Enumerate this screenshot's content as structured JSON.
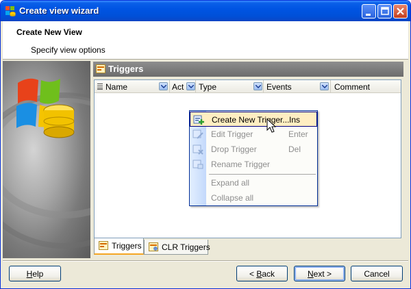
{
  "window": {
    "title": "Create view wizard",
    "icon": "windows-db-icon"
  },
  "header": {
    "title": "Create New View",
    "subtitle": "Specify view options"
  },
  "panel": {
    "title": "Triggers",
    "columns": [
      {
        "label": "Name",
        "dropdown": true
      },
      {
        "label": "Act",
        "dropdown": true
      },
      {
        "label": "Type",
        "dropdown": true
      },
      {
        "label": "Events",
        "dropdown": true
      },
      {
        "label": "Comment",
        "dropdown": false
      }
    ],
    "tabs": [
      {
        "label": "Triggers",
        "active": true
      },
      {
        "label": "CLR Triggers",
        "active": false
      }
    ]
  },
  "context_menu": {
    "items": [
      {
        "label": "Create New Trigger...",
        "shortcut": "Ins",
        "enabled": true,
        "icon": "new-trigger-icon"
      },
      {
        "label": "Edit Trigger",
        "shortcut": "Enter",
        "enabled": false,
        "icon": "edit-trigger-icon"
      },
      {
        "label": "Drop Trigger",
        "shortcut": "Del",
        "enabled": false,
        "icon": "drop-trigger-icon"
      },
      {
        "label": "Rename Trigger",
        "shortcut": "",
        "enabled": false,
        "icon": "rename-trigger-icon"
      },
      {
        "label": "Expand all",
        "shortcut": "",
        "enabled": false,
        "icon": ""
      },
      {
        "label": "Collapse all",
        "shortcut": "",
        "enabled": false,
        "icon": ""
      }
    ]
  },
  "footer": {
    "help": {
      "pre": "",
      "accel": "H",
      "post": "elp"
    },
    "back": {
      "pre": "< ",
      "accel": "B",
      "post": "ack"
    },
    "next": {
      "pre": "",
      "accel": "N",
      "post": "ext >"
    },
    "cancel": {
      "pre": "Cancel",
      "accel": "",
      "post": ""
    }
  },
  "colors": {
    "titlebar": "#0054e3",
    "panel_header": "#7c7c7c",
    "menu_hover": "#ffeec2"
  }
}
